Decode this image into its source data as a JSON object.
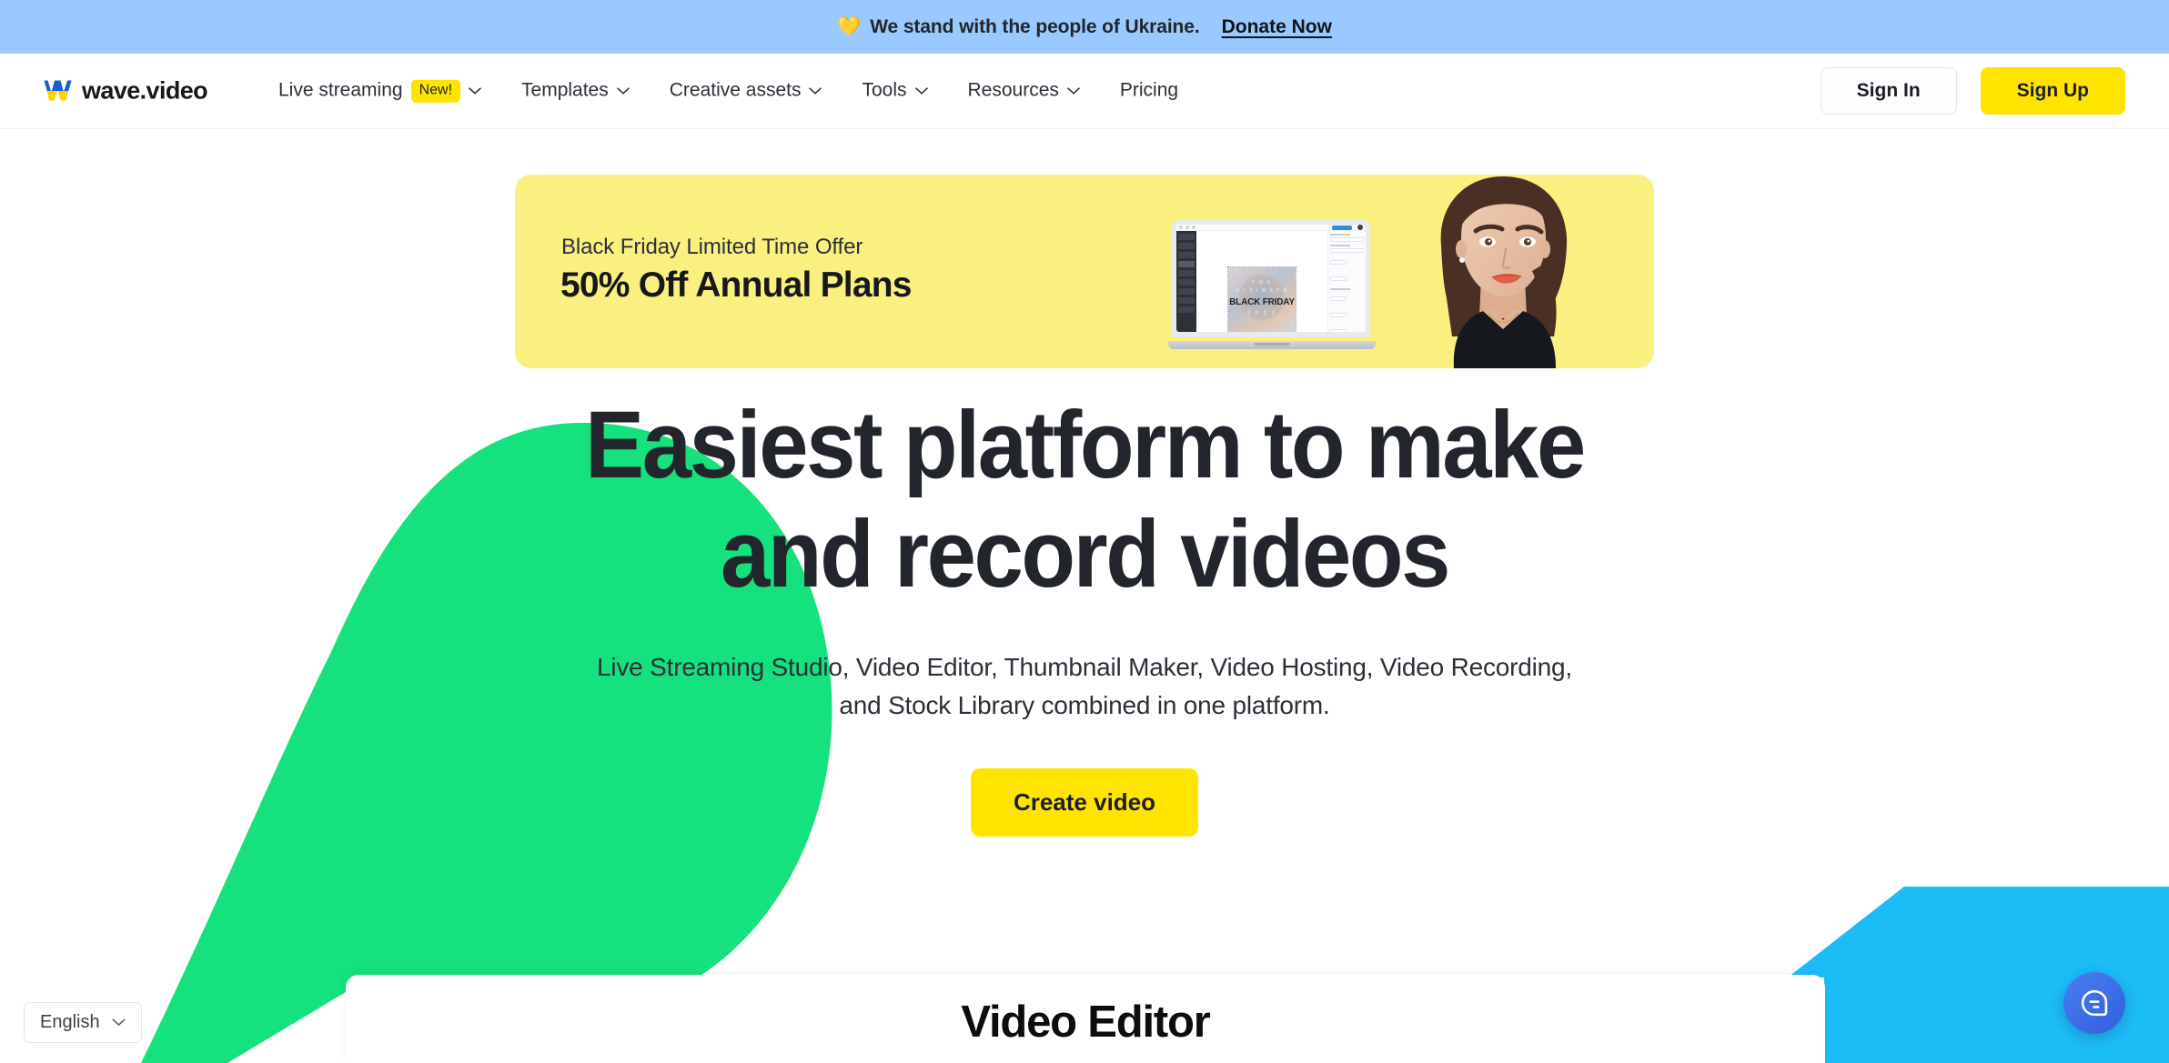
{
  "banner": {
    "heart_icon": "yellow-heart-icon",
    "text": "We stand with the people of Ukraine.",
    "cta": "Donate Now",
    "bg_color": "#99c9ff"
  },
  "header": {
    "logo": {
      "text": "wave.video",
      "mark": "wave-w-icon",
      "colors": [
        "#1560d4",
        "#ffd300"
      ]
    },
    "nav": [
      {
        "label": "Live streaming",
        "badge": "New!",
        "has_chevron": true
      },
      {
        "label": "Templates",
        "badge": null,
        "has_chevron": true
      },
      {
        "label": "Creative assets",
        "badge": null,
        "has_chevron": true
      },
      {
        "label": "Tools",
        "badge": null,
        "has_chevron": true
      },
      {
        "label": "Resources",
        "badge": null,
        "has_chevron": true
      },
      {
        "label": "Pricing",
        "badge": null,
        "has_chevron": false
      }
    ],
    "sign_in": "Sign In",
    "sign_up": "Sign Up",
    "accent_color": "#ffe400"
  },
  "promo": {
    "eyebrow": "Black Friday Limited Time Offer",
    "title": "50% Off Annual Plans",
    "bg_color": "#faf07f",
    "art": {
      "laptop_screen": {
        "line1": "T H E",
        "line2": "U L T I M A T E",
        "line3": "BLACK FRIDAY",
        "line4": "2 0 2 2"
      }
    }
  },
  "hero": {
    "heading_line1": "Easiest platform to make",
    "heading_line2": "and record videos",
    "subheading": "Live Streaming Studio, Video Editor, Thumbnail Maker, Video Hosting, Video Recording, and Stock Library combined in one platform.",
    "cta": "Create video",
    "cta_color": "#ffe400",
    "blob_green": "#15e17e",
    "blob_blue": "#1cbcf7"
  },
  "section": {
    "title": "Video Editor"
  },
  "footer_widgets": {
    "language": "English",
    "language_chevron": "chevron-down-icon",
    "chat": "chat-bubble-icon",
    "chat_color": "#3b6fe8"
  }
}
